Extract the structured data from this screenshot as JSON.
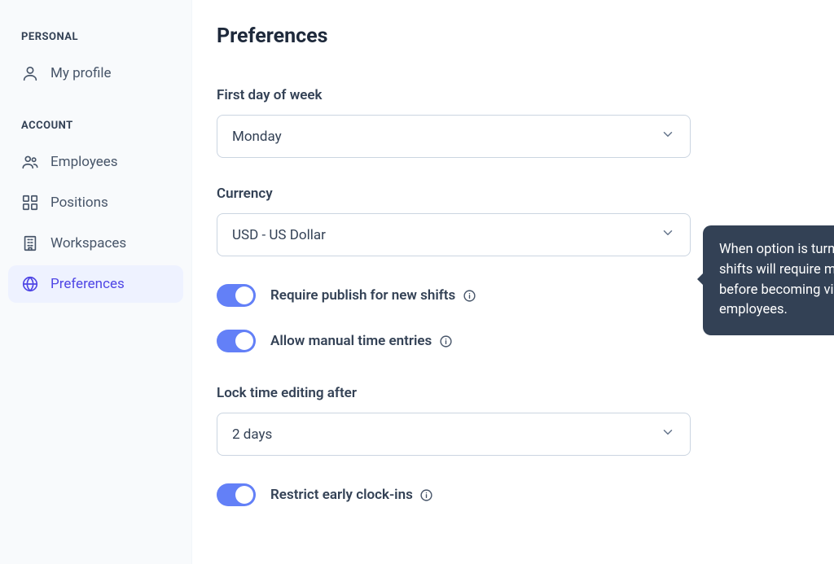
{
  "sidebar": {
    "sections": {
      "personal": {
        "header": "PERSONAL",
        "items": [
          {
            "label": "My profile"
          }
        ]
      },
      "account": {
        "header": "ACCOUNT",
        "items": [
          {
            "label": "Employees"
          },
          {
            "label": "Positions"
          },
          {
            "label": "Workspaces"
          },
          {
            "label": "Preferences"
          }
        ]
      }
    }
  },
  "main": {
    "title": "Preferences",
    "first_day_of_week": {
      "label": "First day of week",
      "value": "Monday"
    },
    "currency": {
      "label": "Currency",
      "value": "USD - US Dollar"
    },
    "require_publish": {
      "label": "Require publish for new shifts",
      "on": true
    },
    "allow_manual_time": {
      "label": "Allow manual time entries",
      "on": true
    },
    "lock_time_editing": {
      "label": "Lock time editing after",
      "value": "2 days"
    },
    "restrict_early_clock_ins": {
      "label": "Restrict early clock-ins",
      "on": true
    },
    "tooltip": {
      "text": "When option is turned on, new shifts will require manual publishing before becoming visible to employees."
    }
  }
}
